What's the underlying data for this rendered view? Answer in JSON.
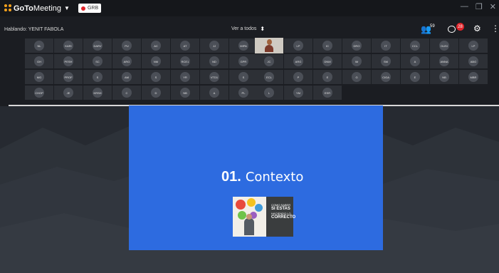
{
  "app": {
    "logo_bold": "GoTo",
    "logo_regular": "Meeting",
    "rec_label": "GRB"
  },
  "subbar": {
    "speaker": "Hablando: YENIT FABOLA",
    "view_all": "Ver a todos",
    "participants_count": "59",
    "chat_badge": "28"
  },
  "participants": [
    [
      "NL",
      "KARI",
      "DARV",
      "PU",
      "AC",
      "AT",
      "JJ",
      "MIPA",
      "",
      "LP",
      "IC",
      "DRO",
      "IT",
      "CCL",
      "DUSI",
      "LP"
    ],
    [
      "GH",
      "PESH",
      "SC",
      "ARG",
      "NM",
      "RCE1",
      "ND",
      "GPR",
      "JC",
      "ARG",
      "DNM",
      "IM",
      "SM",
      "A",
      "ANNA",
      "ABG"
    ],
    [
      "MG",
      "PROF",
      "S",
      "AM",
      "S",
      "YR",
      "VTD1",
      "S",
      "ECL",
      "P",
      "E",
      "G",
      "CIGA",
      "E",
      "NB",
      "MBR"
    ],
    [
      "CHOP",
      "JE",
      "KRSH",
      "C",
      "D",
      "NB",
      "A",
      "PL",
      "L",
      "YM",
      "ESR"
    ]
  ],
  "slide": {
    "number": "01.",
    "title": "Contexto",
    "book_lines": [
      "COMO SABER",
      "SI ESTAS",
      "HACIENDO LO",
      "CORRECTO"
    ]
  },
  "colors": {
    "slide_blue": "#2d6be0",
    "accent_orange": "#f6a21d",
    "record_red": "#e0242a"
  }
}
